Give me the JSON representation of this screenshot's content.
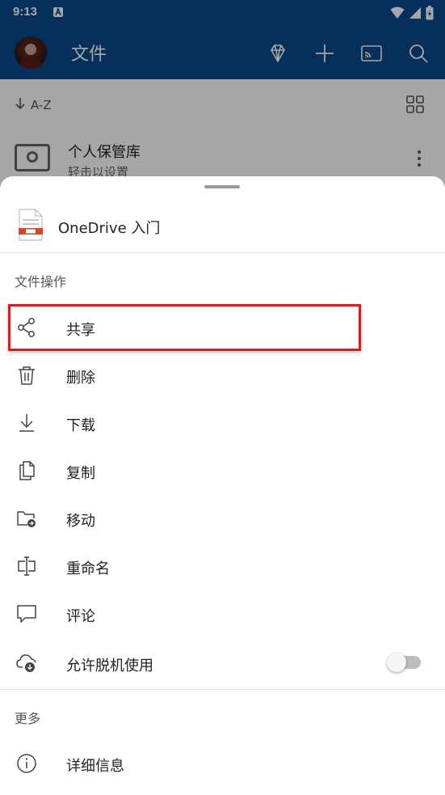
{
  "status_bar": {
    "time": "9:13"
  },
  "app_bar": {
    "title": "文件",
    "actions": [
      "diamond-icon",
      "plus-icon",
      "cast-icon",
      "search-icon"
    ]
  },
  "behind_list": {
    "sort_label": "A-Z",
    "vault": {
      "title": "个人保管库",
      "subtitle": "轻击以设置"
    }
  },
  "sheet": {
    "file_name": "OneDrive 入门",
    "section_file_ops": "文件操作",
    "items": [
      {
        "label": "共享",
        "icon": "share-icon"
      },
      {
        "label": "删除",
        "icon": "trash-icon"
      },
      {
        "label": "下载",
        "icon": "download-icon"
      },
      {
        "label": "复制",
        "icon": "copy-icon"
      },
      {
        "label": "移动",
        "icon": "move-folder-icon"
      },
      {
        "label": "重命名",
        "icon": "rename-icon"
      },
      {
        "label": "评论",
        "icon": "comment-icon"
      },
      {
        "label": "允许脱机使用",
        "icon": "offline-cloud-icon",
        "toggle": false
      }
    ],
    "section_more": "更多",
    "more_items": [
      {
        "label": "详细信息",
        "icon": "info-icon"
      }
    ]
  },
  "colors": {
    "app_bar": "#0a4a8c",
    "highlight": "#d32020",
    "file_icon_accent": "#d24726"
  }
}
